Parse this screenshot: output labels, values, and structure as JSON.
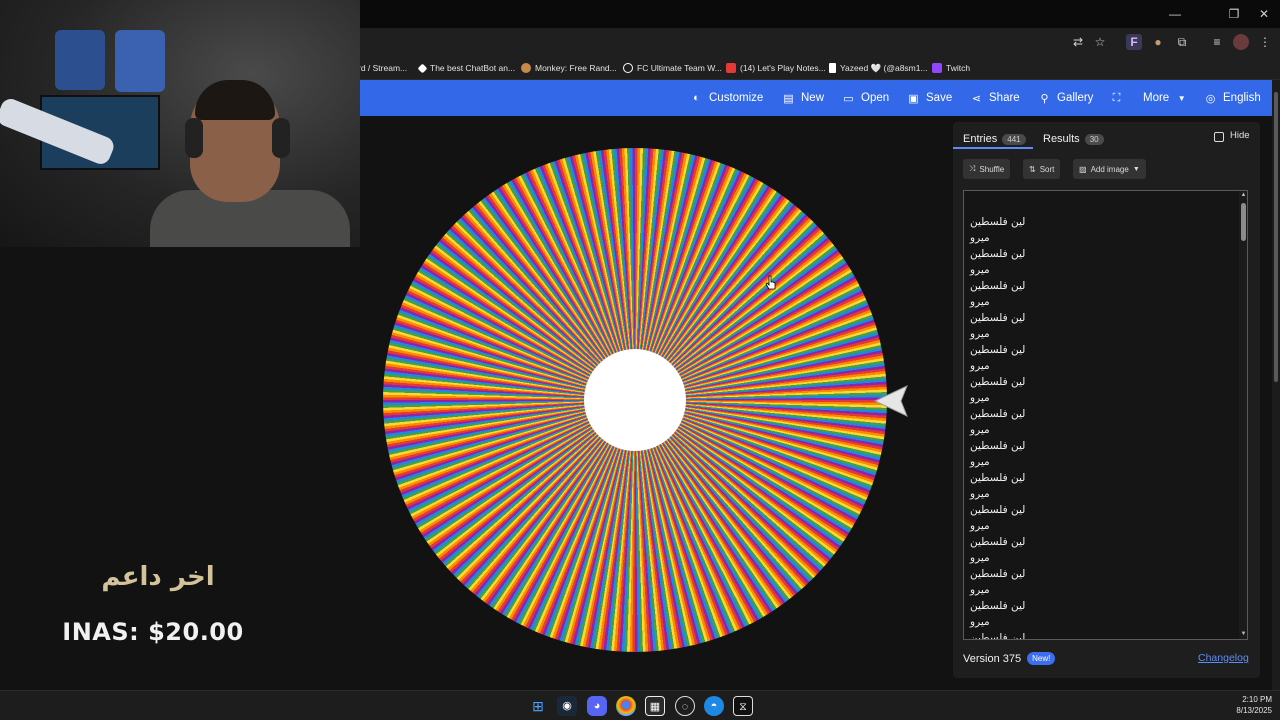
{
  "bookmarks": [
    {
      "label": "rd / Stream...",
      "color": "#222222"
    },
    {
      "label": "The best ChatBot an...",
      "color": "#ffffff"
    },
    {
      "label": "Monkey: Free Rand...",
      "color": "#c68a4d"
    },
    {
      "label": "FC Ultimate Team W...",
      "color": "#ffffff"
    },
    {
      "label": "(14) Let's Play Notes...",
      "color": "#e53935"
    },
    {
      "label": "Yazeed 🤍 (@a8sm1...",
      "color": "#ffffff"
    },
    {
      "label": "Twitch",
      "color": "#9146ff"
    }
  ],
  "nav": {
    "customize": "Customize",
    "new": "New",
    "open": "Open",
    "save": "Save",
    "share": "Share",
    "gallery": "Gallery",
    "more": "More",
    "language": "English"
  },
  "overlay": {
    "last_donor_label": "اخر داعم",
    "donation": "INAS: $20.00"
  },
  "panel": {
    "tabs": [
      {
        "label": "Entries",
        "count": "441"
      },
      {
        "label": "Results",
        "count": "30"
      }
    ],
    "hide_label": "Hide",
    "buttons": {
      "shuffle": "Shuffle",
      "sort": "Sort",
      "add_image": "Add image"
    },
    "entries": [
      "لين فلسطين",
      "ميرو",
      "لين فلسطين",
      "ميرو",
      "لين فلسطين",
      "ميرو",
      "لين فلسطين",
      "ميرو",
      "لين فلسطين",
      "ميرو",
      "لين فلسطين",
      "ميرو",
      "لين فلسطين",
      "ميرو",
      "لين فلسطين",
      "ميرو",
      "لين فلسطين",
      "ميرو",
      "لين فلسطين",
      "ميرو",
      "لين فلسطين",
      "ميرو",
      "لين فلسطين",
      "ميرو",
      "لين فلسطين",
      "ميرو",
      "لين فلسطين"
    ],
    "version_label": "Version 375",
    "new_badge": "New!",
    "changelog": "Changelog"
  },
  "wheel": {
    "colors": [
      "#e53935",
      "#fb8c00",
      "#fdd835",
      "#43a047",
      "#1e88e5",
      "#8e24aa"
    ]
  },
  "taskbar": {
    "time": "2:10 PM",
    "date": "8/13/2025",
    "apps": [
      "windows-start",
      "steam",
      "discord",
      "chrome",
      "epic-games",
      "obs",
      "edge",
      "capcut"
    ]
  }
}
